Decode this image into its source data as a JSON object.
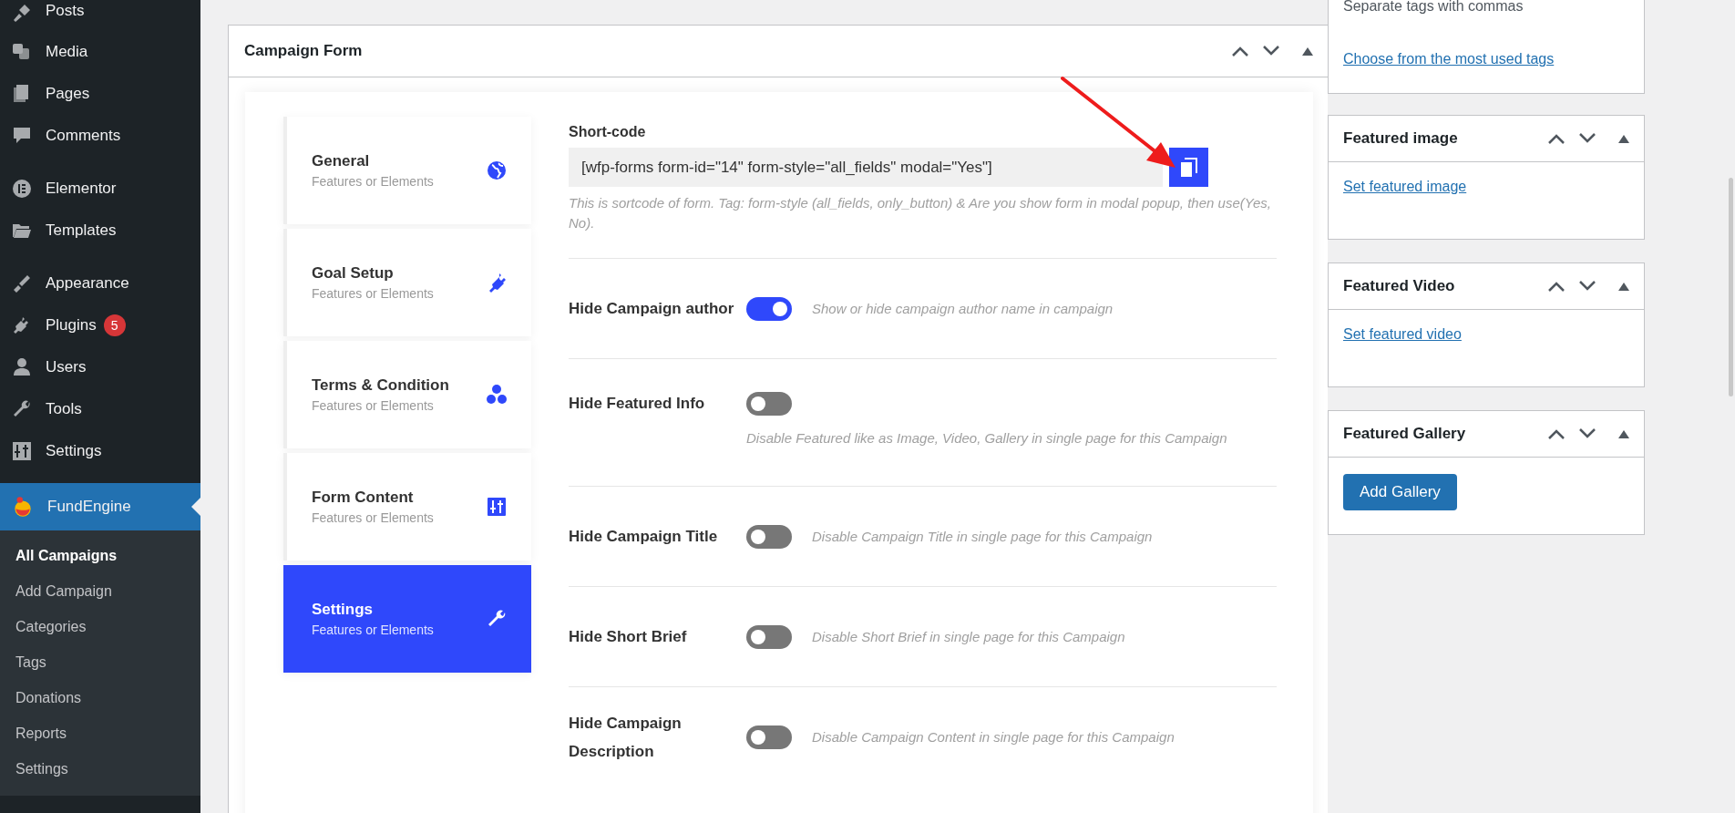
{
  "sidebar": {
    "groups": [
      {
        "items": [
          {
            "label": "Posts",
            "selected": false
          },
          {
            "label": "Media",
            "selected": false
          },
          {
            "label": "Pages",
            "selected": false
          },
          {
            "label": "Comments",
            "selected": false
          }
        ]
      },
      {
        "items": [
          {
            "label": "Elementor",
            "selected": false
          },
          {
            "label": "Templates",
            "selected": false
          }
        ]
      },
      {
        "items": [
          {
            "label": "Appearance",
            "selected": false
          },
          {
            "label": "Plugins",
            "badge": "5",
            "selected": false
          },
          {
            "label": "Users",
            "selected": false
          },
          {
            "label": "Tools",
            "selected": false
          },
          {
            "label": "Settings",
            "selected": false
          }
        ]
      },
      {
        "items": [
          {
            "label": "FundEngine",
            "selected": true
          }
        ]
      }
    ],
    "submenu": [
      {
        "label": "All Campaigns",
        "selected": true
      },
      {
        "label": "Add Campaign",
        "selected": false
      },
      {
        "label": "Categories",
        "selected": false
      },
      {
        "label": "Tags",
        "selected": false
      },
      {
        "label": "Donations",
        "selected": false
      },
      {
        "label": "Reports",
        "selected": false
      },
      {
        "label": "Settings",
        "selected": false
      }
    ]
  },
  "campaign_form": {
    "title": "Campaign Form",
    "tabs": [
      {
        "title": "General",
        "subtitle": "Features or Elements",
        "selected": false
      },
      {
        "title": "Goal Setup",
        "subtitle": "Features or Elements",
        "selected": false
      },
      {
        "title": "Terms & Condition",
        "subtitle": "Features or Elements",
        "selected": false
      },
      {
        "title": "Form Content",
        "subtitle": "Features or Elements",
        "selected": false
      },
      {
        "title": "Settings",
        "subtitle": "Features or Elements",
        "selected": true
      }
    ],
    "shortcode": {
      "label": "Short-code",
      "value": "[wfp-forms form-id=\"14\" form-style=\"all_fields\" modal=\"Yes\"]",
      "help": "This is sortcode of form. Tag: form-style (all_fields, only_button) & Are you show form in modal popup, then use(Yes, No)."
    },
    "settings": [
      {
        "label": "Hide Campaign author",
        "on": true,
        "description": "Show or hide campaign author name in campaign",
        "kind": "inline"
      },
      {
        "label": "Hide Featured Info",
        "on": false,
        "description": "Disable Featured like as Image, Video, Gallery in single page for this Campaign",
        "kind": "stacked"
      },
      {
        "label": "Hide Campaign Title",
        "on": false,
        "description": "Disable Campaign Title in single page for this Campaign",
        "kind": "inline"
      },
      {
        "label": "Hide Short Brief",
        "on": false,
        "description": "Disable Short Brief in single page for this Campaign",
        "kind": "inline"
      },
      {
        "label": "Hide Campaign Description",
        "on": false,
        "description": "Disable Campaign Content in single page for this Campaign",
        "kind": "inline"
      }
    ]
  },
  "tags_box": {
    "hint": "Separate tags with commas",
    "link": "Choose from the most used tags"
  },
  "side_boxes": [
    {
      "title": "Featured image",
      "kind": "link",
      "action": "Set featured image"
    },
    {
      "title": "Featured Video",
      "kind": "link",
      "action": "Set featured video"
    },
    {
      "title": "Featured Gallery",
      "kind": "button",
      "action": "Add Gallery"
    }
  ]
}
